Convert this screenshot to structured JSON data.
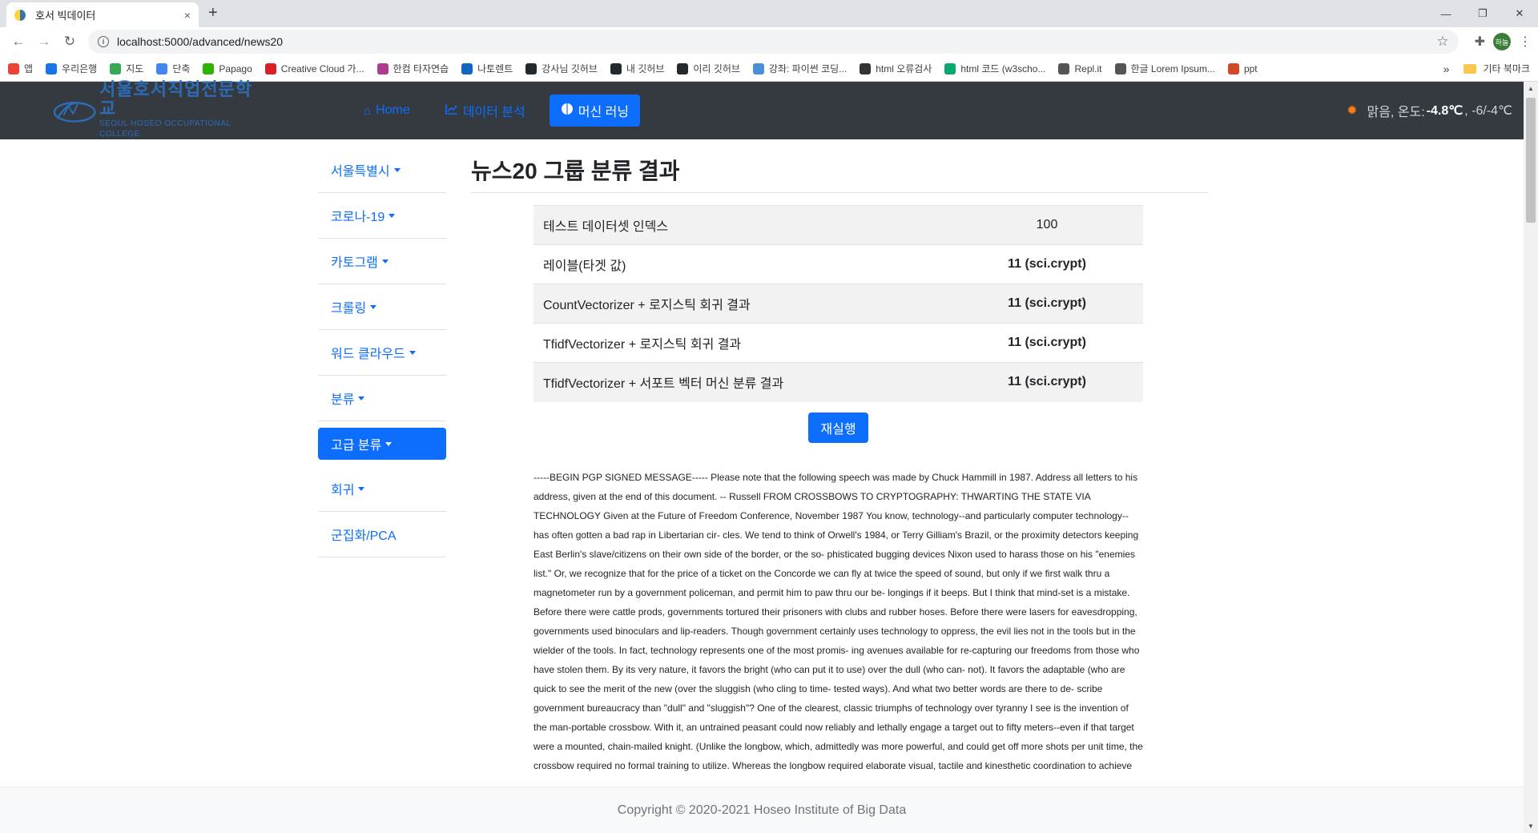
{
  "browser": {
    "tab_title": "호서 빅데이터",
    "tab_close": "×",
    "new_tab": "+",
    "url": "localhost:5000/advanced/news20",
    "win_min": "—",
    "win_restore": "❐",
    "win_close": "✕",
    "profile_initials": "하늘",
    "bookmarks": [
      {
        "label": "앱",
        "color": "#ea4335"
      },
      {
        "label": "우리은행",
        "color": "#1a73e8"
      },
      {
        "label": "지도",
        "color": "#34a853"
      },
      {
        "label": "단축",
        "color": "#4285f4"
      },
      {
        "label": "Papago",
        "color": "#2db400"
      },
      {
        "label": "Creative Cloud 가...",
        "color": "#da1f26"
      },
      {
        "label": "한컴 타자연습",
        "color": "#b03a8c"
      },
      {
        "label": "나토렌트",
        "color": "#1565c0"
      },
      {
        "label": "강사님 깃허브",
        "color": "#24292e"
      },
      {
        "label": "내 깃허브",
        "color": "#24292e"
      },
      {
        "label": "이리 깃허브",
        "color": "#24292e"
      },
      {
        "label": "강좌: 파이썬 코딩...",
        "color": "#4a90d9"
      },
      {
        "label": "html 오류검사",
        "color": "#333333"
      },
      {
        "label": "html 코드 (w3scho...",
        "color": "#04aa6d"
      },
      {
        "label": "Repl.it",
        "color": "#555555"
      },
      {
        "label": "한글 Lorem Ipsum...",
        "color": "#555555"
      },
      {
        "label": "ppt",
        "color": "#d24726"
      }
    ],
    "bookmarks_more": "»",
    "other_bookmarks": "기타 북마크"
  },
  "navbar": {
    "brand_ko": "서울호서직업전문학교",
    "brand_en": "SEOUL HOSEO OCCUPATIONAL COLLEGE",
    "links": [
      {
        "label": "Home",
        "icon": "home-icon",
        "glyph": "⌂"
      },
      {
        "label": "데이터 분석",
        "icon": "chart-icon",
        "glyph": "📈"
      },
      {
        "label": "머신 러닝",
        "icon": "brain-icon",
        "glyph": "●"
      }
    ],
    "weather_icon": "sun-icon",
    "weather_prefix": "맑음, 온도: ",
    "weather_temp": "-4.8℃",
    "weather_range": ", -6/-4℃"
  },
  "sidebar": {
    "items": [
      {
        "label": "서울특별시",
        "dropdown": true
      },
      {
        "label": "코로나-19",
        "dropdown": true
      },
      {
        "label": "카토그램",
        "dropdown": true
      },
      {
        "label": "크롤링",
        "dropdown": true
      },
      {
        "label": "워드 클라우드",
        "dropdown": true
      },
      {
        "label": "분류",
        "dropdown": true
      },
      {
        "label": "고급 분류",
        "dropdown": true,
        "active": true
      },
      {
        "label": "회귀",
        "dropdown": true
      },
      {
        "label": "군집화/PCA",
        "dropdown": false
      }
    ]
  },
  "page": {
    "title": "뉴스20 그룹 분류 결과",
    "rows": [
      {
        "label": "테스트 데이터셋 인덱스",
        "value": "100",
        "bold": false
      },
      {
        "label": "레이블(타겟 값)",
        "value": "11 (sci.crypt)",
        "bold": true
      },
      {
        "label": "CountVectorizer + 로지스틱 회귀 결과",
        "value": "11 (sci.crypt)",
        "bold": true
      },
      {
        "label": "TfidfVectorizer + 로지스틱 회귀 결과",
        "value": "11 (sci.crypt)",
        "bold": true
      },
      {
        "label": "TfidfVectorizer + 서포트 벡터 머신 분류 결과",
        "value": "11 (sci.crypt)",
        "bold": true
      }
    ],
    "rerun_label": "재실행",
    "document_text": "-----BEGIN PGP SIGNED MESSAGE----- Please note that the following speech was made by Chuck Hammill in 1987. Address all letters to his address, given at the end of this document. -- Russell FROM CROSSBOWS TO CRYPTOGRAPHY: THWARTING THE STATE VIA TECHNOLOGY Given at the Future of Freedom Conference, November 1987 You know, technology--and particularly computer technology--has often gotten a bad rap in Libertarian cir- cles. We tend to think of Orwell's 1984, or Terry Gilliam's Brazil, or the proximity detectors keeping East Berlin's slave/citizens on their own side of the border, or the so- phisticated bugging devices Nixon used to harass those on his \"enemies list.\" Or, we recognize that for the price of a ticket on the Concorde we can fly at twice the speed of sound, but only if we first walk thru a magnetometer run by a government policeman, and permit him to paw thru our be- longings if it beeps. But I think that mind-set is a mistake. Before there were cattle prods, governments tortured their prisoners with clubs and rubber hoses. Before there were lasers for eavesdropping, governments used binoculars and lip-readers. Though government certainly uses technology to oppress, the evil lies not in the tools but in the wielder of the tools. In fact, technology represents one of the most promis- ing avenues available for re-capturing our freedoms from those who have stolen them. By its very nature, it favors the bright (who can put it to use) over the dull (who can- not). It favors the adaptable (who are quick to see the merit of the new (over the sluggish (who cling to time- tested ways). And what two better words are there to de- scribe government bureaucracy than \"dull\" and \"sluggish\"? One of the clearest, classic triumphs of technology over tyranny I see is the invention of the man-portable crossbow. With it, an untrained peasant could now reliably and lethally engage a target out to fifty meters--even if that target were a mounted, chain-mailed knight. (Unlike the longbow, which, admittedly was more powerful, and could get off more shots per unit time, the crossbow required no formal training to utilize. Whereas the longbow required elaborate visual, tactile and kinesthetic coordination to achieve"
  },
  "footer": {
    "copyright": "Copyright © 2020-2021 Hoseo Institute of Big Data"
  }
}
